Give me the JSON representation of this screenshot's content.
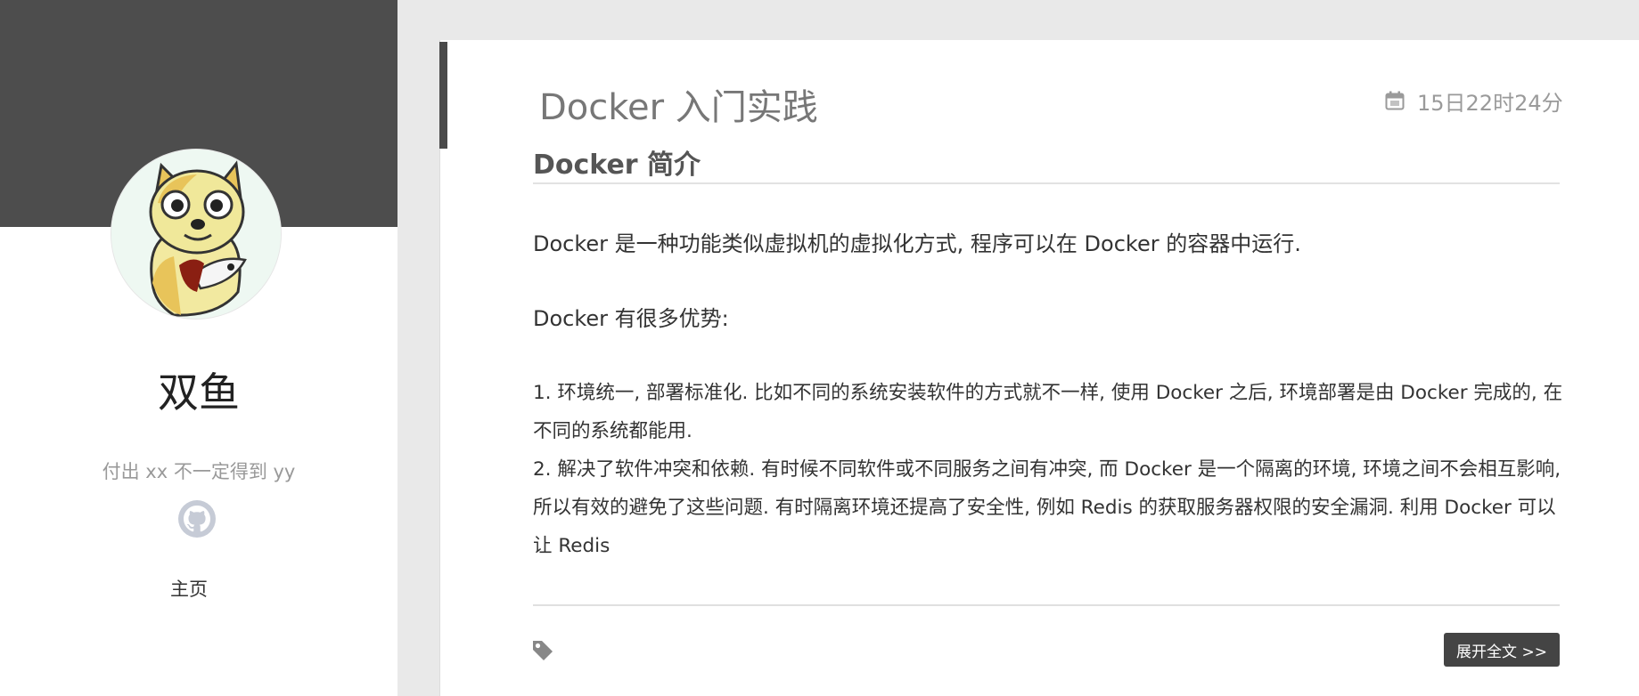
{
  "sidebar": {
    "site_name": "双鱼",
    "motto": "付出 xx 不一定得到 yy",
    "nav": {
      "home": "主页"
    },
    "icons": {
      "github": "github-icon"
    }
  },
  "post": {
    "title": "Docker 入门实践",
    "date": "15日22时24分",
    "section_heading": "Docker 简介",
    "paragraphs": [
      "Docker 是一种功能类似虚拟机的虚拟化方式, 程序可以在 Docker 的容器中运行.",
      "Docker 有很多优势:"
    ],
    "list_items": [
      "1.  环境统一, 部署标准化. 比如不同的系统安装软件的方式就不一样, 使用 Docker 之后, 环境部署是由 Docker 完成的, 在不同的系统都能用.",
      "2.  解决了软件冲突和依赖. 有时候不同软件或不同服务之间有冲突, 而 Docker 是一个隔离的环境, 环境之间不会相互影响, 所以有效的避免了这些问题. 有时隔离环境还提高了安全性, 例如 Redis 的获取服务器权限的安全漏洞. 利用 Docker 可以让 Redis"
    ],
    "read_more": "展开全文 >>",
    "icons": {
      "date": "calendar-icon",
      "tag": "tag-icon"
    }
  },
  "colors": {
    "banner": "#4d4d4d",
    "background": "#e9e9e9",
    "button": "#444444",
    "github_circle": "#c6cbd6"
  }
}
